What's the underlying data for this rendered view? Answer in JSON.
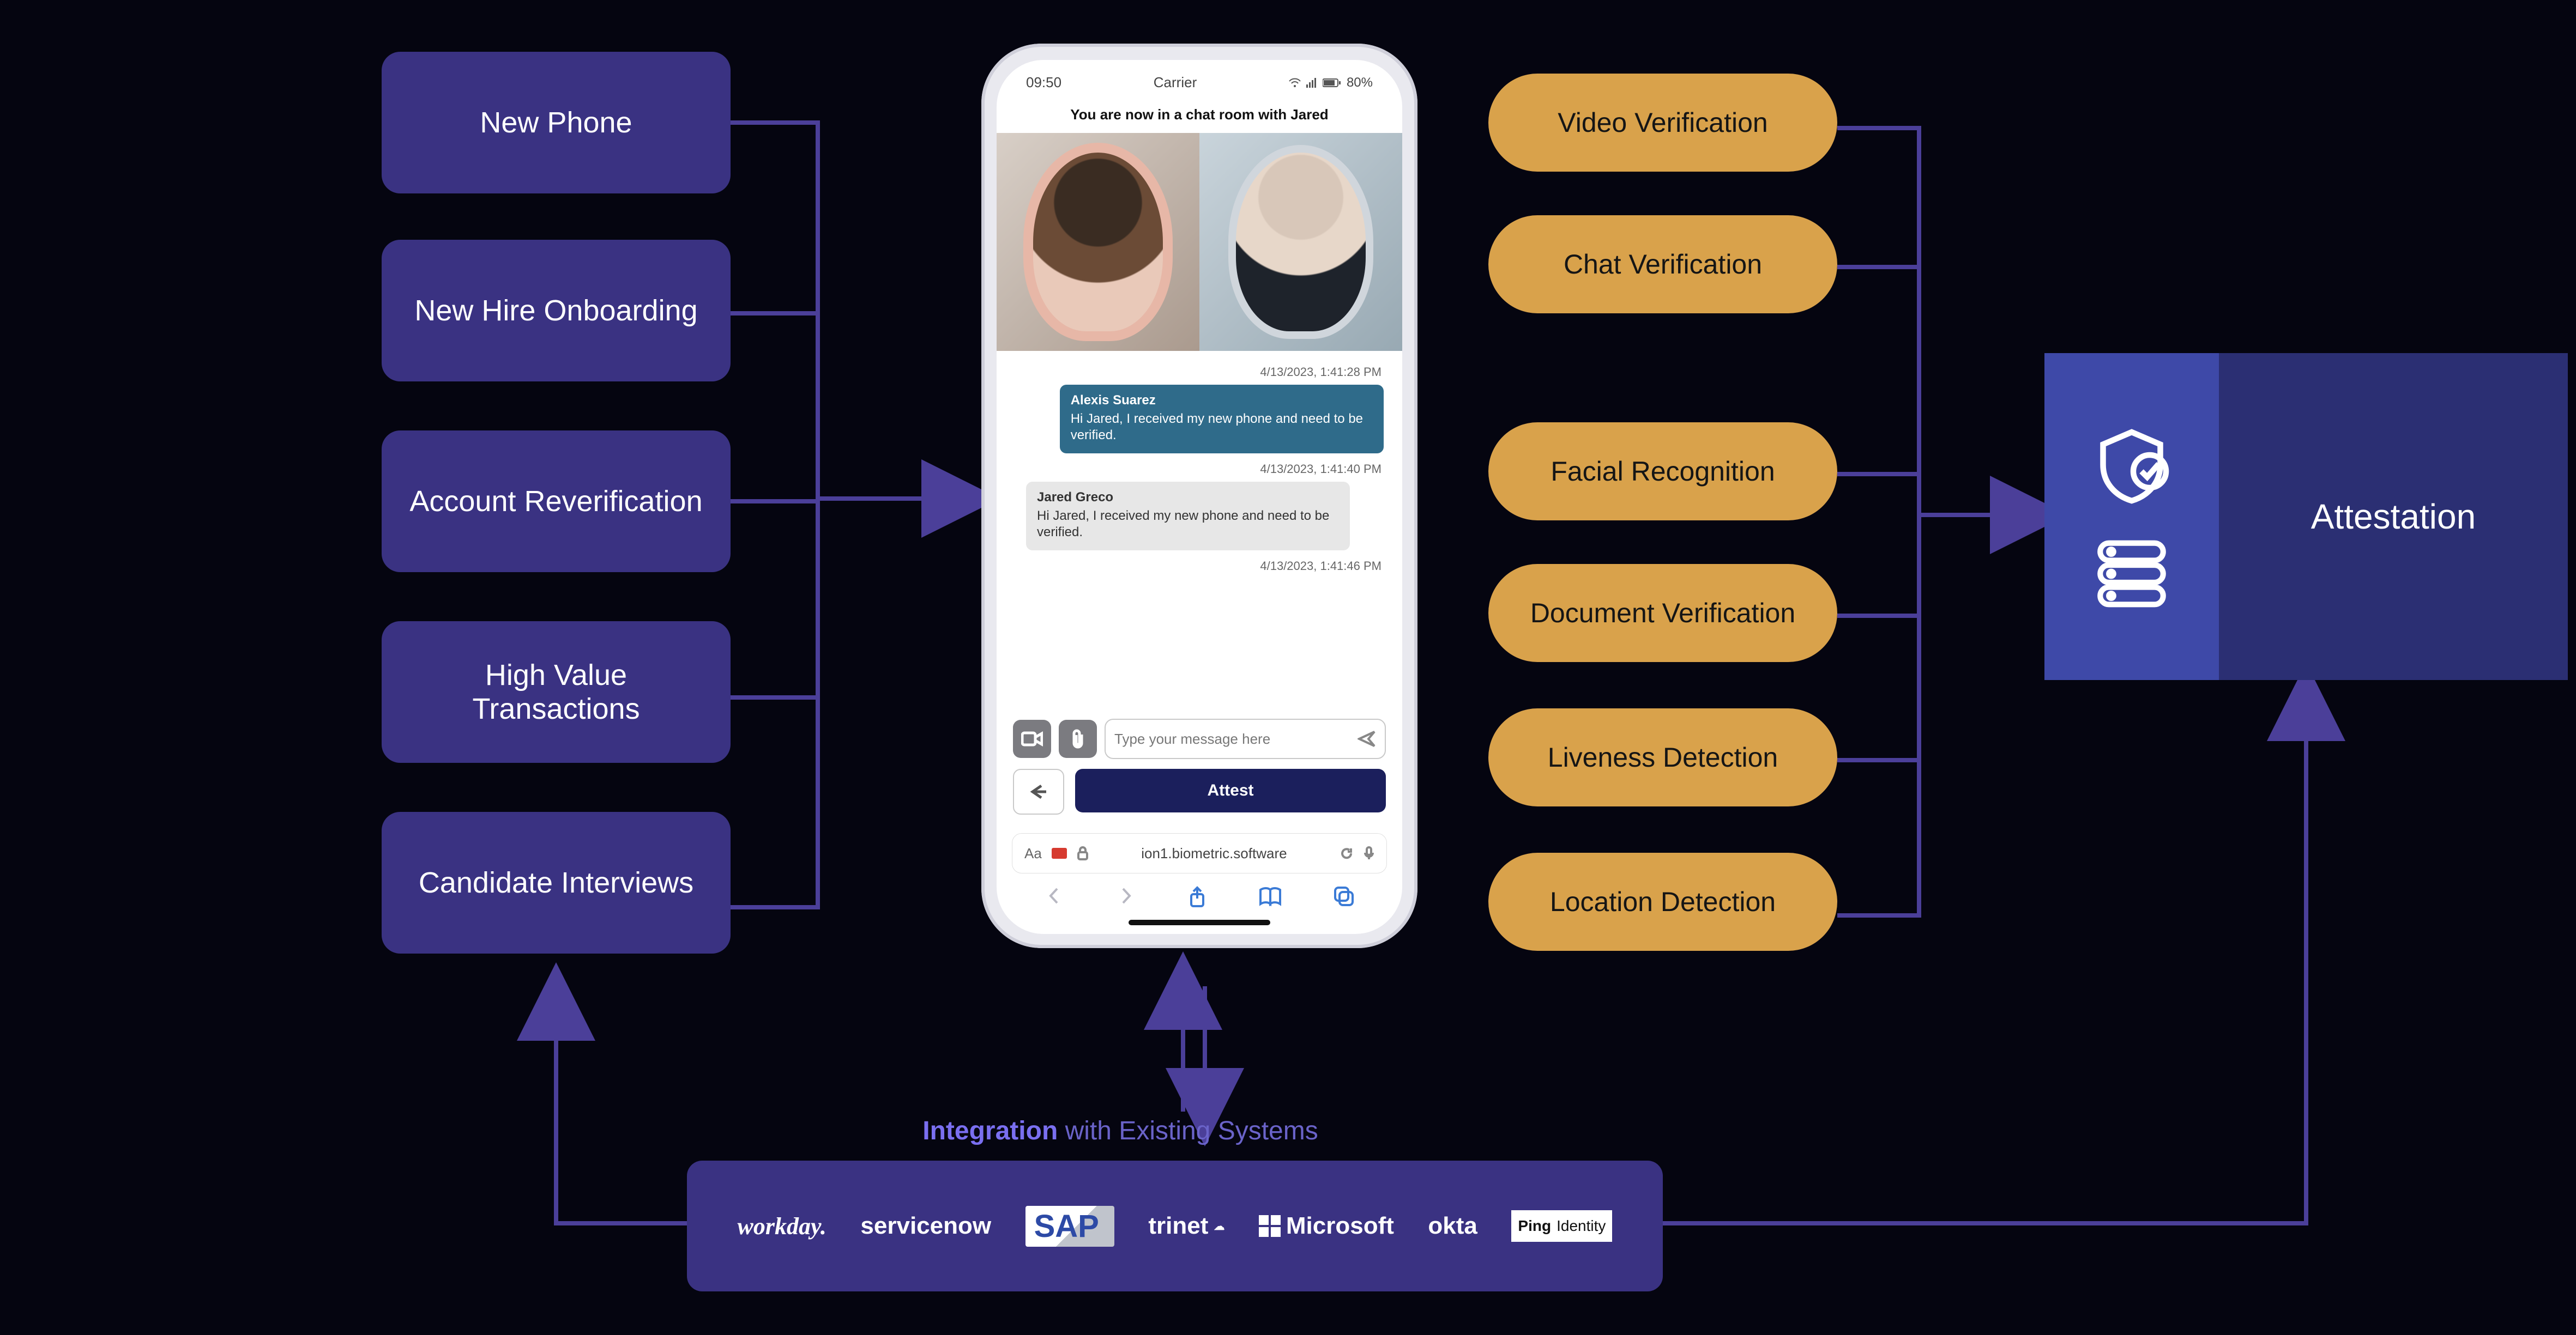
{
  "usecases": [
    {
      "label": "New Phone"
    },
    {
      "label": "New Hire Onboarding"
    },
    {
      "label": "Account Reverification"
    },
    {
      "label": "High Value Transactions"
    },
    {
      "label": "Candidate Interviews"
    }
  ],
  "verification_top": [
    {
      "label": "Video Verification"
    },
    {
      "label": "Chat Verification"
    }
  ],
  "verification_bottom": [
    {
      "label": "Facial Recognition"
    },
    {
      "label": "Document Verification"
    },
    {
      "label": "Liveness Detection"
    },
    {
      "label": "Location Detection"
    }
  ],
  "attestation": {
    "label": "Attestation"
  },
  "integration": {
    "prefix": "Integration",
    "suffix": " with Existing Systems",
    "logos": [
      "workday.",
      "servicenow",
      "SAP",
      "trinet",
      "Microsoft",
      "okta",
      "Ping Identity"
    ]
  },
  "phone": {
    "status": {
      "time": "09:50",
      "carrier": "Carrier",
      "battery": "80%"
    },
    "chat_header": "You are now in a chat room with Jared",
    "messages": [
      {
        "ts": "4/13/2023, 1:41:28 PM",
        "name": "Alexis Suarez",
        "text": "Hi Jared, I received my new phone and need to be verified.",
        "side": "sent"
      },
      {
        "ts": "4/13/2023, 1:41:40 PM",
        "name": "Jared Greco",
        "text": "Hi Jared, I received my new phone and need to be verified.",
        "side": "recv"
      },
      {
        "ts_only": "4/13/2023, 1:41:46 PM"
      }
    ],
    "compose_placeholder": "Type your message here",
    "attest_button": "Attest",
    "url": "ion1.biometric.software",
    "url_prefix": "Aa"
  }
}
